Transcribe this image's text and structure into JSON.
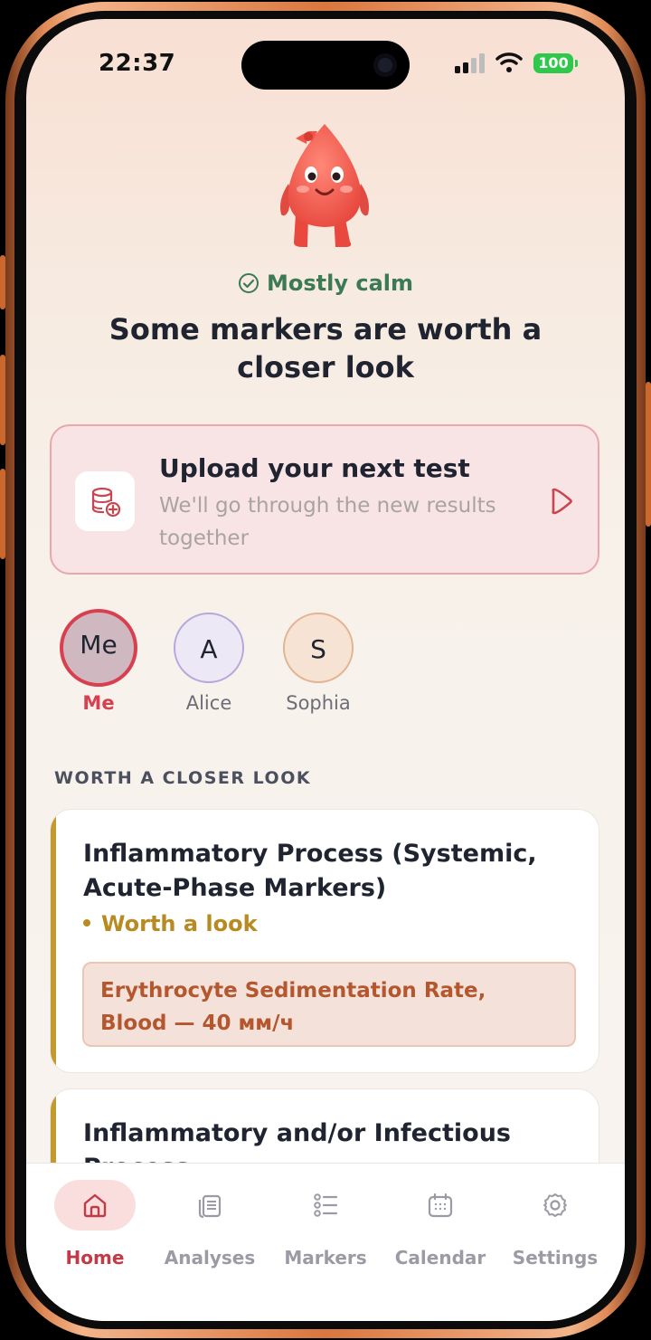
{
  "status_bar": {
    "time": "22:37",
    "battery": "100"
  },
  "hero": {
    "mood": "Mostly calm",
    "headline": "Some markers are worth a closer look"
  },
  "upload": {
    "title": "Upload your next test",
    "subtitle": "We'll go through the new results together"
  },
  "profiles": [
    {
      "initials": "Me",
      "name": "Me"
    },
    {
      "initials": "A",
      "name": "Alice"
    },
    {
      "initials": "S",
      "name": "Sophia"
    }
  ],
  "section": {
    "title": "WORTH A CLOSER LOOK"
  },
  "cards": [
    {
      "title": "Inflammatory Process (Systemic, Acute-Phase Markers)",
      "status": "Worth a look",
      "marker": "Erythrocyte Sedimentation Rate, Blood — 40 мм/ч"
    },
    {
      "title": "Inflammatory and/or Infectious Process"
    }
  ],
  "tabs": [
    {
      "label": "Home",
      "icon": "home-icon"
    },
    {
      "label": "Analyses",
      "icon": "documents-icon"
    },
    {
      "label": "Markers",
      "icon": "list-icon"
    },
    {
      "label": "Calendar",
      "icon": "calendar-icon"
    },
    {
      "label": "Settings",
      "icon": "gear-icon"
    }
  ],
  "colors": {
    "accent": "#c23a46",
    "calm": "#3b7a55",
    "warning": "#b78a22",
    "marker_text": "#b4562e"
  }
}
